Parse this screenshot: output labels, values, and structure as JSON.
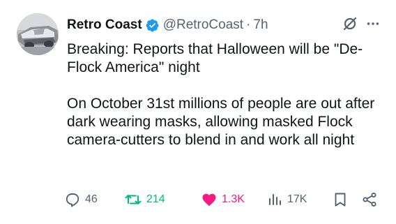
{
  "author": {
    "display_name": "Retro Coast",
    "handle": "@RetroCoast",
    "separator": "·",
    "time": "7h"
  },
  "tweet": {
    "paragraph1": "Breaking: Reports that Halloween will be \"De-Flock America\" night",
    "paragraph2": "On October 31st millions of people are out after dark wearing masks, allowing masked Flock camera-cutters to blend in and work all night"
  },
  "actions": {
    "replies": "46",
    "retweets": "214",
    "likes": "1.3K",
    "views": "17K"
  },
  "icons": {
    "avatar": "car-avatar",
    "verified": "verified-badge-icon",
    "grok": "grok-icon",
    "more": "more-icon",
    "reply": "reply-icon",
    "retweet": "retweet-icon",
    "like": "heart-icon",
    "views": "views-icon",
    "bookmark": "bookmark-icon",
    "share": "share-icon"
  },
  "colors": {
    "text": "#0f1419",
    "muted": "#536471",
    "verified": "#1d9bf0",
    "retweet": "#00ba7c",
    "like": "#f91880"
  }
}
